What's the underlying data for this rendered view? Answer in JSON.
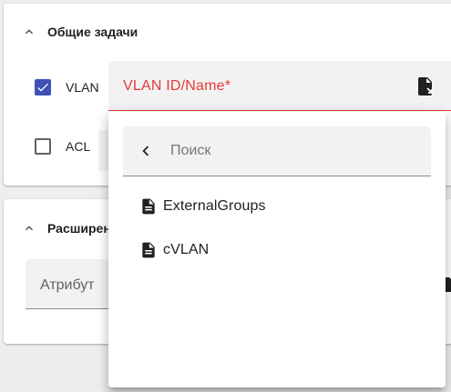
{
  "general": {
    "title": "Общие задачи",
    "vlan_label": "VLAN",
    "vlan_checked": true,
    "acl_label": "ACL",
    "acl_checked": false,
    "vlan_field_label": "VLAN ID/Name*"
  },
  "advanced": {
    "title": "Расширен",
    "attribute_label": "Атрибут"
  },
  "dropdown": {
    "search_placeholder": "Поиск",
    "items": [
      {
        "label": "ExternalGroups",
        "icon": "document-icon"
      },
      {
        "label": "cVLAN",
        "icon": "document-icon"
      }
    ]
  },
  "colors": {
    "accent": "#3f51b5",
    "error": "#e53935",
    "field_bg": "#f2f2f2"
  }
}
